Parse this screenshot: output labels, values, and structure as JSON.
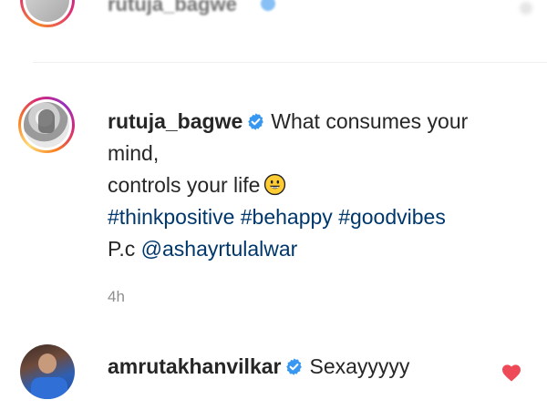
{
  "top_comment": {
    "username": "rutuja_bagwe"
  },
  "post": {
    "username": "rutuja_bagwe",
    "caption_line1": "What consumes your",
    "caption_line2": "mind,",
    "caption_line3": "controls your life",
    "emoji": "grinning-face-emoji",
    "hashtags": [
      "#thinkpositive",
      "#behappy",
      "#goodvibes"
    ],
    "pc_label": "P.c",
    "mention": "@ashayrtulalwar",
    "time": "4h"
  },
  "comment": {
    "username": "amrutakhanvilkar",
    "text": "Sexayyyyy",
    "heart": "heart-icon"
  },
  "colors": {
    "verified": "#3897f0",
    "link": "#00376b",
    "heart": "#ed4956",
    "meta": "#8e8e8e"
  }
}
